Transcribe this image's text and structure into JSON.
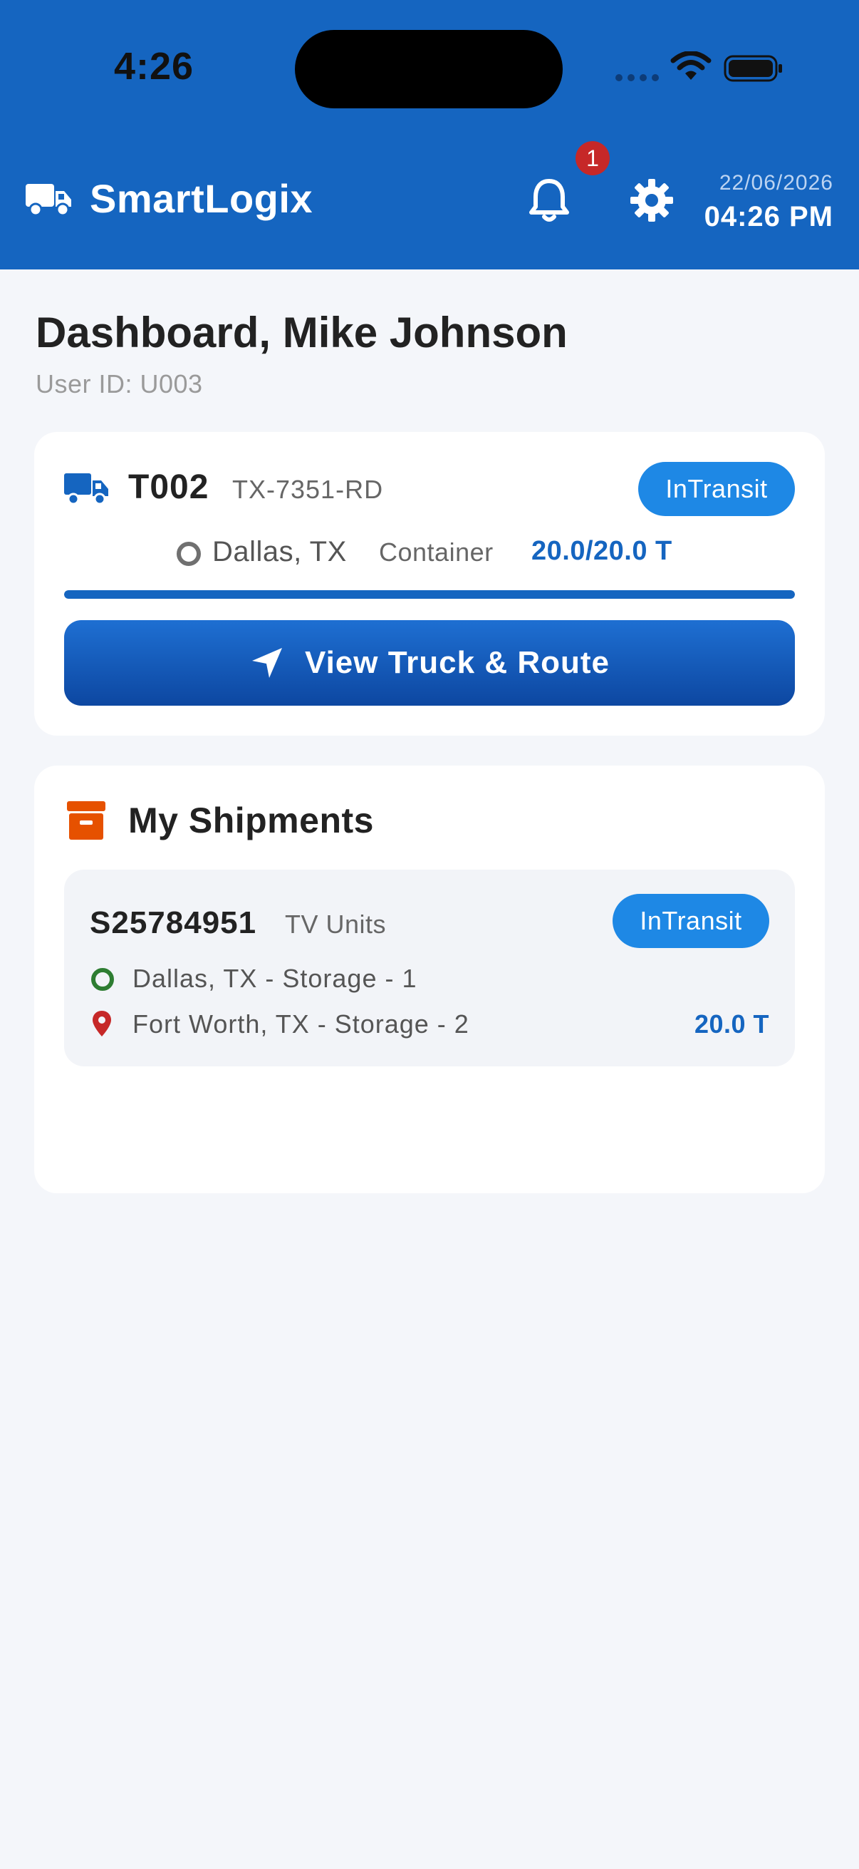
{
  "status_bar": {
    "time": "4:26",
    "icons": [
      "signal-icon",
      "wifi-icon",
      "battery-icon"
    ]
  },
  "header": {
    "logo_icon": "truck-icon",
    "app_title": "SmartLogix",
    "notification_count": "1",
    "date": "22/06/2026",
    "time": "04:26 PM",
    "background_color": "#1565c0"
  },
  "page": {
    "title": "Dashboard, Mike Johnson",
    "user_id": "User ID: U003"
  },
  "truck": {
    "id": "T002",
    "plate": "TX-7351-RD",
    "status": "InTransit",
    "location": "Dallas, TX",
    "cargo_type": "Container",
    "load": "20.0/20.0 T",
    "load_fraction": 1.0,
    "action_label": "View Truck & Route"
  },
  "shipments": {
    "title": "My Shipments",
    "items": [
      {
        "id": "S25784951",
        "type": "TV Units",
        "status": "InTransit",
        "origin": "Dallas, TX - Storage - 1",
        "destination": "Fort Worth, TX - Storage - 2",
        "weight": "20.0 T"
      }
    ]
  },
  "colors": {
    "accent": "#1565c0",
    "status_pill": "#1e88e5",
    "shipment_icon": "#e65100",
    "origin_marker": "#2e7d32",
    "destination_marker": "#c62828",
    "badge": "#c62828"
  }
}
